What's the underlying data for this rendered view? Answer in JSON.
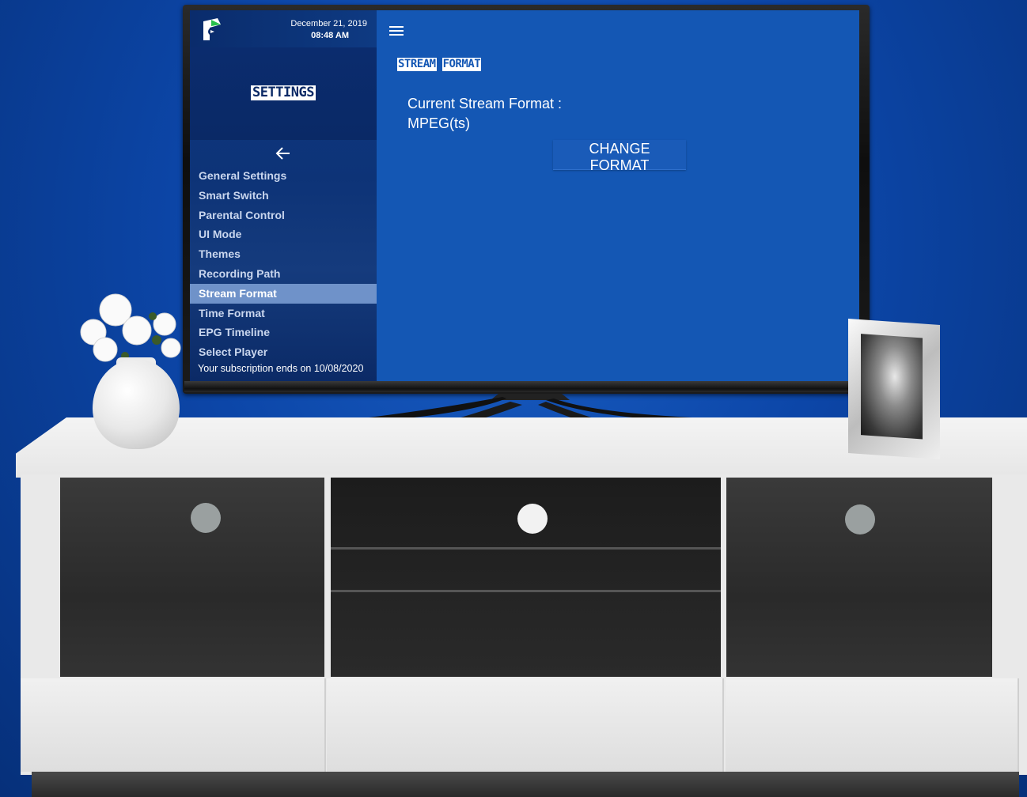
{
  "header": {
    "date": "December 21, 2019",
    "time": "08:48 AM"
  },
  "sidebar": {
    "title": "SETTINGS",
    "back_icon": "arrow-left-icon",
    "items": [
      {
        "label": "General Settings"
      },
      {
        "label": "Smart Switch"
      },
      {
        "label": "Parental Control"
      },
      {
        "label": "UI Mode"
      },
      {
        "label": "Themes"
      },
      {
        "label": "Recording Path"
      },
      {
        "label": "Stream Format",
        "active": true
      },
      {
        "label": "Time Format"
      },
      {
        "label": "EPG Timeline"
      },
      {
        "label": "Select Player"
      }
    ],
    "subscription": "Your subscription ends on 10/08/2020"
  },
  "main": {
    "menu_icon": "hamburger-icon",
    "title_words": [
      "STREAM",
      "FORMAT"
    ],
    "current_label": "Current Stream Format :",
    "current_value": "MPEG(ts)",
    "change_button": "CHANGE FORMAT"
  },
  "colors": {
    "background": "#0c46a8",
    "screen": "#1457b4",
    "sidebar": "#0d3377",
    "active_item": "#6f92c9"
  }
}
